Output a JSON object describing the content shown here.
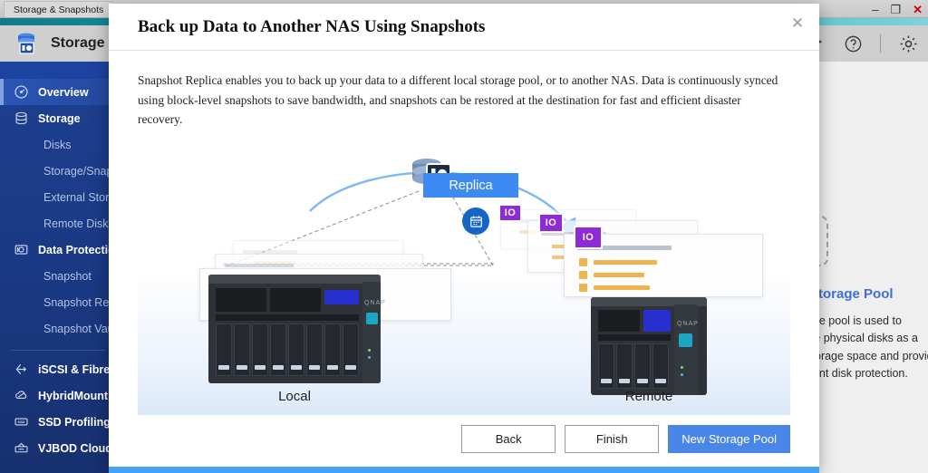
{
  "os": {
    "taskbar_tab": "Storage & Snapshots",
    "minimize": "–",
    "maximize": "❐",
    "close": "✕"
  },
  "app": {
    "title": "Storage & Snapshots",
    "icon": "storage-snapshot-icon",
    "tools": [
      {
        "name": "magic-wand-icon",
        "label": ""
      },
      {
        "name": "help-icon",
        "label": "?"
      },
      {
        "name": "settings-gear-icon",
        "label": ""
      }
    ]
  },
  "sidebar": {
    "items": [
      {
        "label": "Overview",
        "icon": "gauge-icon",
        "level": "main",
        "active": true
      },
      {
        "label": "Storage",
        "icon": "disk-stack-icon",
        "level": "main",
        "active": false
      },
      {
        "label": "Disks",
        "icon": "",
        "level": "sub",
        "active": false
      },
      {
        "label": "Storage/Snapshots",
        "icon": "",
        "level": "sub",
        "active": false
      },
      {
        "label": "External Storage",
        "icon": "",
        "level": "sub",
        "active": false
      },
      {
        "label": "Remote Disk",
        "icon": "",
        "level": "sub",
        "active": false
      },
      {
        "label": "Data Protection",
        "icon": "camera-icon",
        "level": "main",
        "active": false
      },
      {
        "label": "Snapshot",
        "icon": "",
        "level": "sub",
        "active": false
      },
      {
        "label": "Snapshot Replica",
        "icon": "",
        "level": "sub",
        "active": false
      },
      {
        "label": "Snapshot Vault",
        "icon": "",
        "level": "sub",
        "active": false
      }
    ],
    "items_bottom": [
      {
        "label": "iSCSI & Fibre Channel",
        "icon": "iscsi-icon"
      },
      {
        "label": "HybridMount",
        "icon": "cloud-mount-icon"
      },
      {
        "label": "SSD Profiling Tool",
        "icon": "ssd-icon"
      },
      {
        "label": "VJBOD Cloud",
        "icon": "vjbod-cloud-icon"
      }
    ]
  },
  "background_panel": {
    "card_title": "New Storage Pool",
    "card_desc": "A storage pool is used to combine physical disks as a large storage space and provide redundant disk protection.",
    "plus_icon": "add-storage-pool-icon"
  },
  "modal": {
    "title": "Back up Data to Another NAS Using Snapshots",
    "close_icon": "close-icon",
    "description": "Snapshot Replica enables you to back up your data to a different local storage pool, or to another NAS. Data is continuously synced using block-level snapshots to save bandwidth, and snapshots can be restored at the destination for fast and efficient disaster recovery.",
    "illustration": {
      "replica_badge": "Replica",
      "local_label": "Local",
      "remote_label": "Remote",
      "calendar_icon": "schedule-calendar-icon",
      "disk_icon": "snapshot-disk-icon",
      "arrow_icon": "replication-arrow-icon",
      "snapshot_badge_text": "IO",
      "nas_brand": "QNAP"
    },
    "buttons": [
      {
        "label": "Back",
        "name": "back-button",
        "style": "secondary"
      },
      {
        "label": "Finish",
        "name": "finish-button",
        "style": "secondary"
      },
      {
        "label": "New Storage Pool",
        "name": "new-storage-pool-button",
        "style": "primary"
      }
    ]
  },
  "colors": {
    "accent_blue": "#4a86e8",
    "replica_blue": "#3d8bf2",
    "snapshot_purple": "#8e2bd6",
    "sidebar_blue": "#1d3f8f",
    "teal_bar": "#16a0ac",
    "link_blue": "#3f6fd8"
  }
}
